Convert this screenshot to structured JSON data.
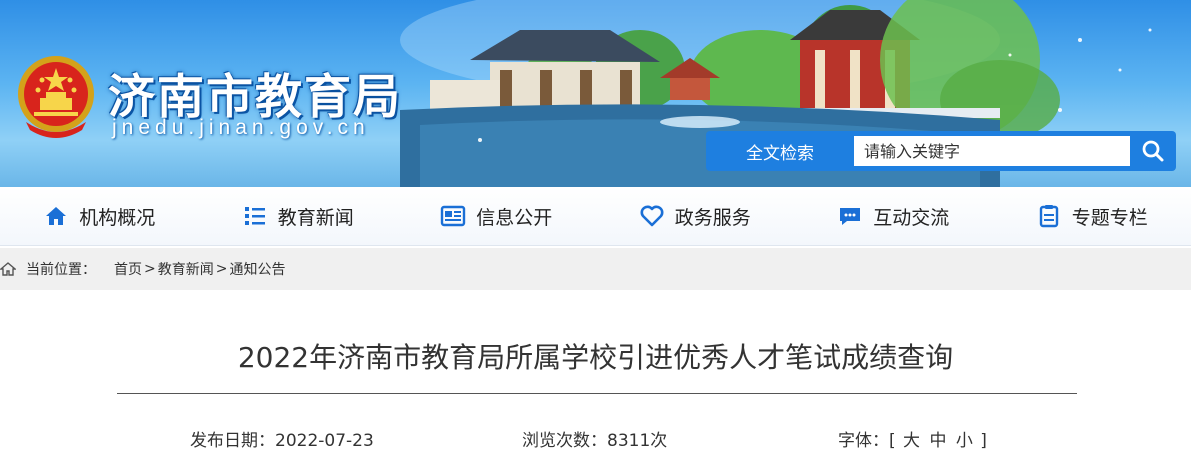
{
  "header": {
    "site_title": "济南市教育局",
    "site_url": "jnedu.jinan.gov.cn",
    "search": {
      "label": "全文检索",
      "placeholder": "请输入关键字"
    }
  },
  "nav": {
    "items": [
      {
        "label": "机构概况",
        "icon": "home-icon"
      },
      {
        "label": "教育新闻",
        "icon": "list-icon"
      },
      {
        "label": "信息公开",
        "icon": "newspaper-icon"
      },
      {
        "label": "政务服务",
        "icon": "heart-icon"
      },
      {
        "label": "互动交流",
        "icon": "chat-icon"
      },
      {
        "label": "专题专栏",
        "icon": "clipboard-icon"
      }
    ]
  },
  "breadcrumb": {
    "label": "当前位置：",
    "items": [
      "首页",
      "教育新闻",
      "通知公告"
    ],
    "separator": ">"
  },
  "article": {
    "title": "2022年济南市教育局所属学校引进优秀人才笔试成绩查询",
    "date_label": "发布日期：",
    "date": "2022-07-23",
    "views_label": "浏览次数：",
    "views": "8311次",
    "font_label": "字体：",
    "font_open": "[",
    "font_large": "大",
    "font_medium": "中",
    "font_small": "小",
    "font_close": "]"
  },
  "colors": {
    "accent": "#1e7fe0",
    "nav_icon": "#1a6fd6"
  }
}
